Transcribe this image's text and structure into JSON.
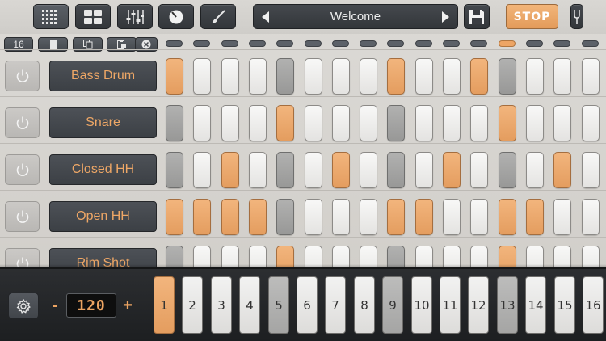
{
  "toolbar": {
    "buttons": [
      {
        "name": "pattern-grid",
        "active": true
      },
      {
        "name": "kit-grid",
        "active": false
      },
      {
        "name": "mixer",
        "active": false
      },
      {
        "name": "knob",
        "active": false
      },
      {
        "name": "edit-brush",
        "active": false
      }
    ],
    "preset_title": "Welcome",
    "stop_label": "STOP"
  },
  "tools": {
    "steps_label": "16"
  },
  "playing_step": 13,
  "tracks": [
    {
      "name": "Bass Drum",
      "steps": [
        1,
        0,
        0,
        0,
        0,
        0,
        0,
        0,
        1,
        0,
        0,
        1,
        0,
        0,
        0,
        0
      ]
    },
    {
      "name": "Snare",
      "steps": [
        0,
        0,
        0,
        0,
        1,
        0,
        0,
        0,
        0,
        0,
        0,
        0,
        1,
        0,
        0,
        0
      ]
    },
    {
      "name": "Closed HH",
      "steps": [
        0,
        0,
        1,
        0,
        0,
        0,
        1,
        0,
        0,
        0,
        1,
        0,
        0,
        0,
        1,
        0
      ]
    },
    {
      "name": "Open HH",
      "steps": [
        1,
        1,
        1,
        1,
        0,
        0,
        0,
        0,
        1,
        1,
        0,
        0,
        1,
        1,
        0,
        0
      ]
    },
    {
      "name": "Rim Shot",
      "steps": [
        0,
        0,
        0,
        0,
        1,
        0,
        0,
        0,
        0,
        0,
        0,
        0,
        1,
        0,
        0,
        0
      ]
    }
  ],
  "tempo": {
    "minus_label": "-",
    "value": "120",
    "plus_label": "+"
  },
  "step_selector": {
    "labels": [
      "1",
      "2",
      "3",
      "4",
      "5",
      "6",
      "7",
      "8",
      "9",
      "10",
      "11",
      "12",
      "13",
      "14",
      "15",
      "16"
    ],
    "active": 1
  },
  "colors": {
    "accent": "#eca462",
    "panel": "#3c4045",
    "beat_marker": "#a5a5a4"
  },
  "icons": {
    "power": "power-icon",
    "settings": "gear-icon",
    "prev": "triangle-left-icon",
    "next": "triangle-right-icon",
    "save": "floppy-disk-icon",
    "tuning": "tuning-fork-icon"
  }
}
